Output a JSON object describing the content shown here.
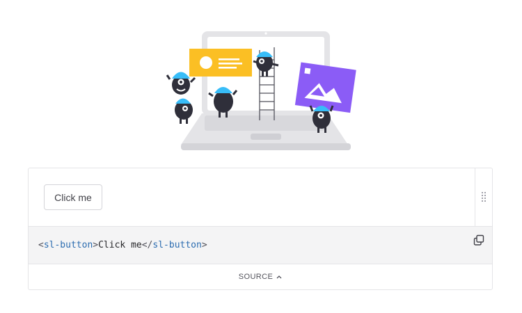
{
  "hero": {
    "illustration": "monsters-building-laptop-illustration"
  },
  "example": {
    "button_label": "Click me",
    "code": {
      "open_lt": "<",
      "open_tag": "sl-button",
      "open_gt": ">",
      "content": "Click me",
      "close_lt": "</",
      "close_tag": "sl-button",
      "close_gt": ">"
    },
    "source_label": "SOURCE"
  },
  "colors": {
    "accent_yellow": "#fbbf24",
    "accent_purple": "#8b5cf6",
    "monster_blue": "#38bdf8",
    "monster_body": "#2f2f3a",
    "tag_blue": "#2b6cb0"
  },
  "icons": {
    "resize": "grip-vertical-icon",
    "copy": "copy-icon",
    "chevron": "chevron-up-icon"
  }
}
